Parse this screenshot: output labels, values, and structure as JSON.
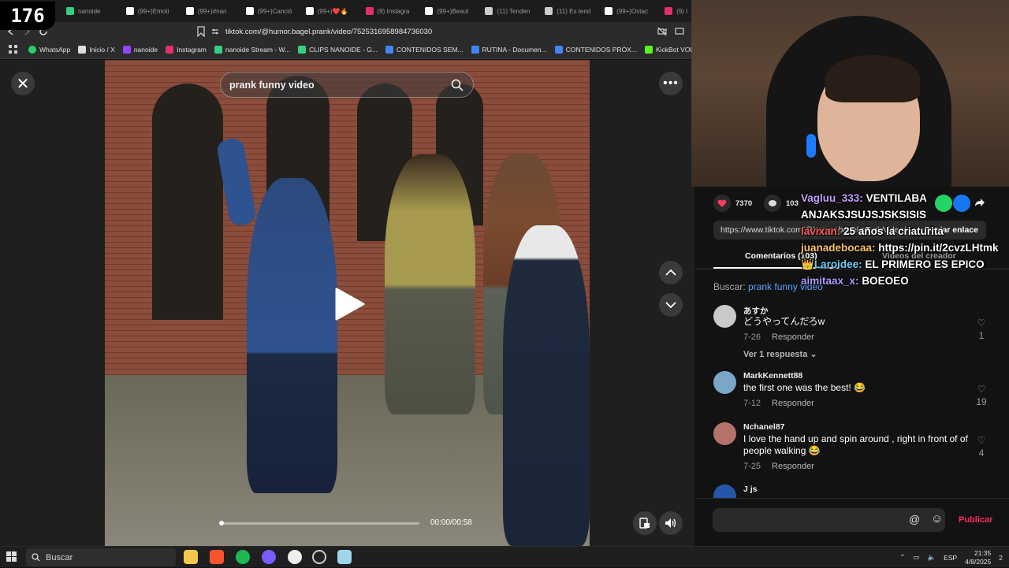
{
  "overlay": {
    "viewer_count": "176"
  },
  "browser": {
    "tabs": [
      {
        "label": "nanoide",
        "color": "#35d07f"
      },
      {
        "label": "(99+)Emoti",
        "color": "#ffffff"
      },
      {
        "label": "(99+)#nan",
        "color": "#ffffff"
      },
      {
        "label": "(99+)Canció",
        "color": "#ffffff"
      },
      {
        "label": "(99+)❤️🔥",
        "color": "#ffffff"
      },
      {
        "label": "(9) Instagra",
        "color": "#e1306c"
      },
      {
        "label": "(99+)Beaut",
        "color": "#ffffff"
      },
      {
        "label": "(11) Tenden",
        "color": "#cccccc"
      },
      {
        "label": "(11) Es tend",
        "color": "#cccccc"
      },
      {
        "label": "(99+)Ostac",
        "color": "#ffffff"
      },
      {
        "label": "(9) I",
        "color": "#e1306c"
      }
    ],
    "url": "tiktok.com/@humor.bagel.prank/video/7525316958984736030",
    "bookmarks": [
      {
        "label": "WhatsApp",
        "color": "#25d366"
      },
      {
        "label": "Inicio / X",
        "color": "#dddddd"
      },
      {
        "label": "nanoide",
        "color": "#9146ff"
      },
      {
        "label": "Instagram",
        "color": "#e1306c"
      },
      {
        "label": "nanoide Stream - W...",
        "color": "#35d07f"
      },
      {
        "label": "CLIPS NANOIDE - G...",
        "color": "#35d07f"
      },
      {
        "label": "CONTENIDOS SEM...",
        "color": "#4285f4"
      },
      {
        "label": "RUTINA - Documen...",
        "color": "#4285f4"
      },
      {
        "label": "CONTENIDOS PRÓX...",
        "color": "#4285f4"
      },
      {
        "label": "KickBot VOD Dowlo",
        "color": "#53fc18"
      }
    ]
  },
  "video": {
    "search_text": "prank funny video",
    "time": "00:00/00:58",
    "progress": 0.0
  },
  "panel": {
    "likes": "7370",
    "comments_count": "103",
    "link_text": "https://www.tiktok.com/@humor.bagel.prank/video/...",
    "copy_link": "Copiar enlace",
    "tab_comments": "Comentarios (103)",
    "tab_creator": "Videos del creador",
    "search_label": "Buscar:",
    "search_term": "prank funny video",
    "comments": [
      {
        "user": "あすか",
        "text": "どうやってんだろw",
        "date": "7-26",
        "reply": "Responder",
        "likes": "1",
        "avatar": "#c9c9c9"
      },
      {
        "user": "MarkKennett88",
        "text": "the first one was the best! 😂",
        "date": "7-12",
        "reply": "Responder",
        "likes": "19",
        "avatar": "#7aa6c8"
      },
      {
        "user": "Nchanel87",
        "text": "I love the hand up and spin around , right in front of of people walking 😂",
        "date": "7-25",
        "reply": "Responder",
        "likes": "4",
        "avatar": "#b5726a"
      },
      {
        "user": "J js",
        "text": "",
        "date": "",
        "reply": "",
        "likes": "",
        "avatar": "#2457a8"
      }
    ],
    "see_replies": "Ver 1 respuesta",
    "publish": "Publicar"
  },
  "chat": [
    {
      "user": "Vagluu_333:",
      "text": "VENTILABA ANJAKSJSUJSJSKSISIS"
    },
    {
      "user": "lavixan:",
      "text": "25 años la criaturita"
    },
    {
      "user": "juanadebocaa:",
      "text": "https://pin.it/2cvzLHtmk"
    },
    {
      "user": "Laroidee:",
      "text": "EL PRIMERO ES EPICO"
    },
    {
      "user": "aimitaax_x:",
      "text": "BOEOEO"
    }
  ],
  "taskbar": {
    "search": "Buscar",
    "lang": "ESP",
    "time": "21:35",
    "date": "4/8/2025",
    "notifications": "2"
  }
}
